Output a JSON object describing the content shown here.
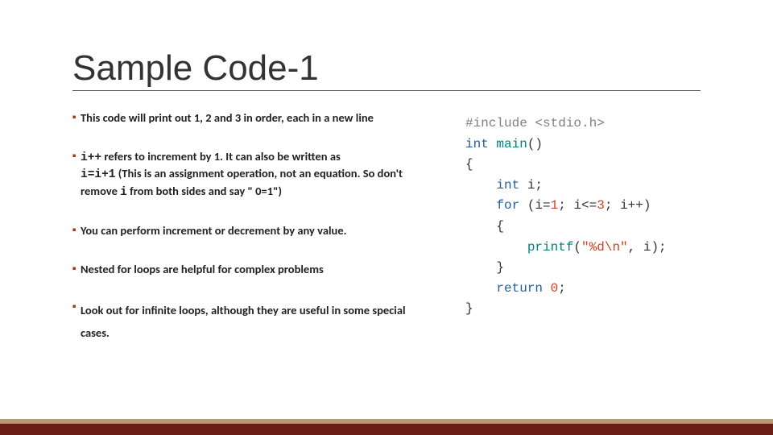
{
  "title": "Sample Code-1",
  "bullets": {
    "b1": "This code will print out 1, 2 and 3 in order, each in a new line",
    "b2_code1": "i++",
    "b2_mid": " refers to increment by 1. It can also be written as ",
    "b2_code2": "i=i+1",
    "b2_after": " (This is an assignment operation, not an equation. So don't remove ",
    "b2_code3": "i",
    "b2_end": " from both sides and say \" 0=1\")",
    "b3": "You can perform increment or decrement by any value.",
    "b4": "Nested for loops are helpful for complex problems",
    "b5": "Look out for infinite loops, although they are useful in some special cases."
  },
  "code": {
    "include_hash": "#include",
    "include_hdr": "<stdio.h>",
    "int": "int",
    "main": "main",
    "parens": "()",
    "lbrace": "{",
    "rbrace": "}",
    "decl_i": "i;",
    "for": "for",
    "for_open": "(i=",
    "one": "1",
    "semi_ile": "; i<=",
    "three": "3",
    "semi_ipp": "; i++)",
    "printf": "printf",
    "printf_open": "(",
    "fmt": "\"%d\\n\"",
    "printf_close": ", i);",
    "return": "return",
    "zero": "0",
    "ret_semi": ";"
  }
}
